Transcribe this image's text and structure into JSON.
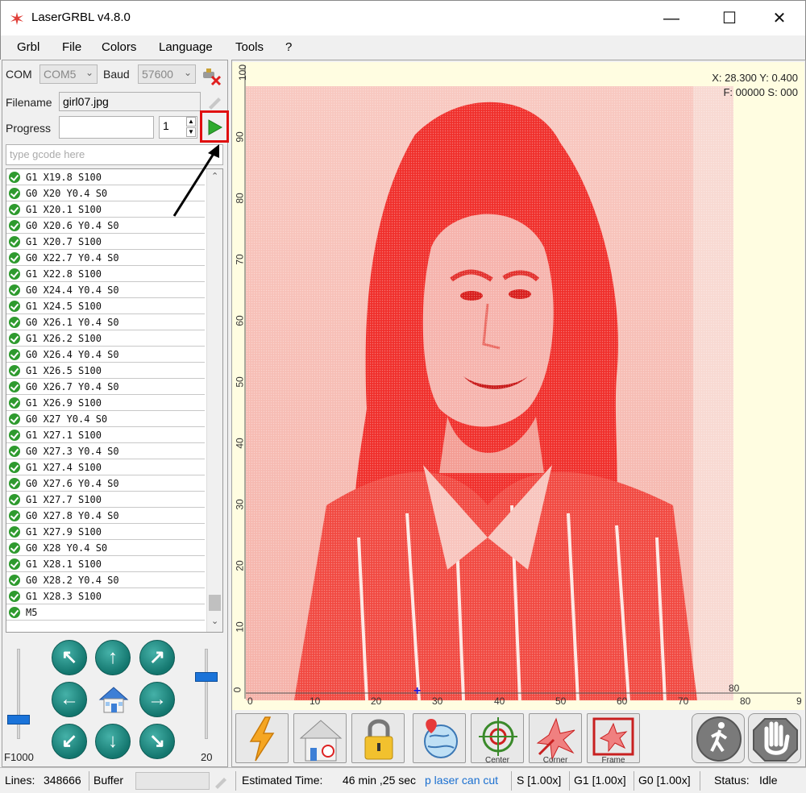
{
  "window": {
    "title": "LaserGRBL v4.8.0",
    "minimize": "—",
    "maximize": "☐",
    "close": "✕"
  },
  "menu": [
    "Grbl",
    "File",
    "Colors",
    "Language",
    "Tools",
    "?"
  ],
  "connection": {
    "com_label": "COM",
    "com_value": "COM5",
    "baud_label": "Baud",
    "baud_value": "57600"
  },
  "file": {
    "filename_label": "Filename",
    "filename_value": "girl07.jpg"
  },
  "progress": {
    "label": "Progress",
    "value": "",
    "copies": "1"
  },
  "gcode_input": {
    "placeholder": "type gcode here"
  },
  "command_log": [
    "G1 X19.8 S100",
    "G0 X20 Y0.4 S0",
    "G1 X20.1 S100",
    "G0 X20.6 Y0.4 S0",
    "G1 X20.7 S100",
    "G0 X22.7 Y0.4 S0",
    "G1 X22.8 S100",
    "G0 X24.4 Y0.4 S0",
    "G1 X24.5 S100",
    "G0 X26.1 Y0.4 S0",
    "G1 X26.2 S100",
    "G0 X26.4 Y0.4 S0",
    "G1 X26.5 S100",
    "G0 X26.7 Y0.4 S0",
    "G1 X26.9 S100",
    "G0 X27 Y0.4 S0",
    "G1 X27.1 S100",
    "G0 X27.3 Y0.4 S0",
    "G1 X27.4 S100",
    "G0 X27.6 Y0.4 S0",
    "G1 X27.7 S100",
    "G0 X27.8 Y0.4 S0",
    "G1 X27.9 S100",
    "G0 X28 Y0.4 S0",
    "G1 X28.1 S100",
    "G0 X28.2 Y0.4 S0",
    "G1 X28.3 S100",
    "M5"
  ],
  "jog": {
    "feed_label": "F1000",
    "step_label": "20",
    "feed_level": 0.28,
    "step_level": 0.8
  },
  "viewer": {
    "coords_line1": "X: 28.300 Y: 0.400",
    "coords_line2": "F: 00000 S: 000",
    "y_ticks": [
      "100",
      "90",
      "80",
      "70",
      "60",
      "50",
      "40",
      "30",
      "20",
      "10",
      "0"
    ],
    "x_ticks": [
      "0",
      "10",
      "20",
      "30",
      "40",
      "50",
      "60",
      "70",
      "80",
      "9"
    ],
    "corner_label": "80"
  },
  "toolbar": {
    "center_caption": "Center",
    "corner_caption": "Corner",
    "frame_caption": "Frame"
  },
  "status": {
    "lines_label": "Lines:",
    "lines_value": "348666",
    "buffer_label": "Buffer",
    "est_label": "Estimated Time:",
    "est_value": "46 min ,25 sec",
    "marquee": "p laser can cut",
    "s_override": "S [1.00x]",
    "g1_override": "G1 [1.00x]",
    "g0_override": "G0 [1.00x]",
    "status_label": "Status:",
    "status_value": "Idle"
  },
  "colors": {
    "accent_green": "#2e9a2e",
    "engrave_red": "#f02a2a",
    "highlight": "#e01010"
  }
}
